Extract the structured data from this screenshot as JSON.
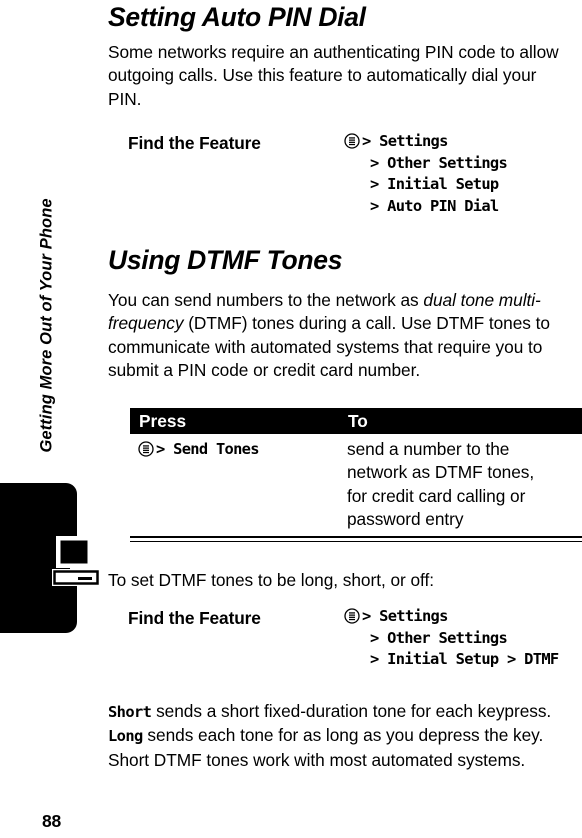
{
  "document": {
    "running_head": "Getting More Out of Your Phone",
    "page_number": "88"
  },
  "sections": [
    {
      "id": "auto-pin-dial",
      "title": "Setting Auto PIN Dial",
      "body": "Some networks require an authenticating PIN code to allow outgoing calls. Use this feature to automatically dial your PIN."
    },
    {
      "id": "dtmf-tones",
      "title": "Using DTMF Tones",
      "body_before_italic": "You can send numbers to the network as ",
      "body_italic": "dual tone multi-frequency",
      "body_after_italic": " (DTMF) tones during a call. Use DTMF tones to communicate with automated systems that require you to submit a PIN code or credit card number."
    }
  ],
  "find_the_feature_1": {
    "label": "Find the Feature",
    "icon": "menu-key-icon",
    "steps": [
      "> Settings",
      "> Other Settings",
      "> Initial Setup",
      "> Auto PIN Dial"
    ]
  },
  "press_table": {
    "headers": {
      "press": "Press",
      "to": "To"
    },
    "rows": [
      {
        "press_icon": "menu-key-icon",
        "press": "> Send Tones",
        "to": "send a number to the network as DTMF tones, for credit card calling or password entry"
      }
    ]
  },
  "intro_to_dtmf_settings": "To set DTMF tones to be long, short, or off:",
  "find_the_feature_2": {
    "label": "Find the Feature",
    "icon": "menu-key-icon",
    "steps": [
      "> Settings",
      "> Other Settings",
      "> Initial Setup > DTMF"
    ]
  },
  "closing_paragraph": {
    "term_1": "Short",
    "text_1": " sends a short fixed-duration tone for each keypress. ",
    "term_2": "Long",
    "text_2": " sends each tone for as long as you depress the key. Short DTMF tones work with most automated systems."
  },
  "thumb_tab": {
    "icon": "computer-and-telephone-icon",
    "color": "#000000"
  }
}
